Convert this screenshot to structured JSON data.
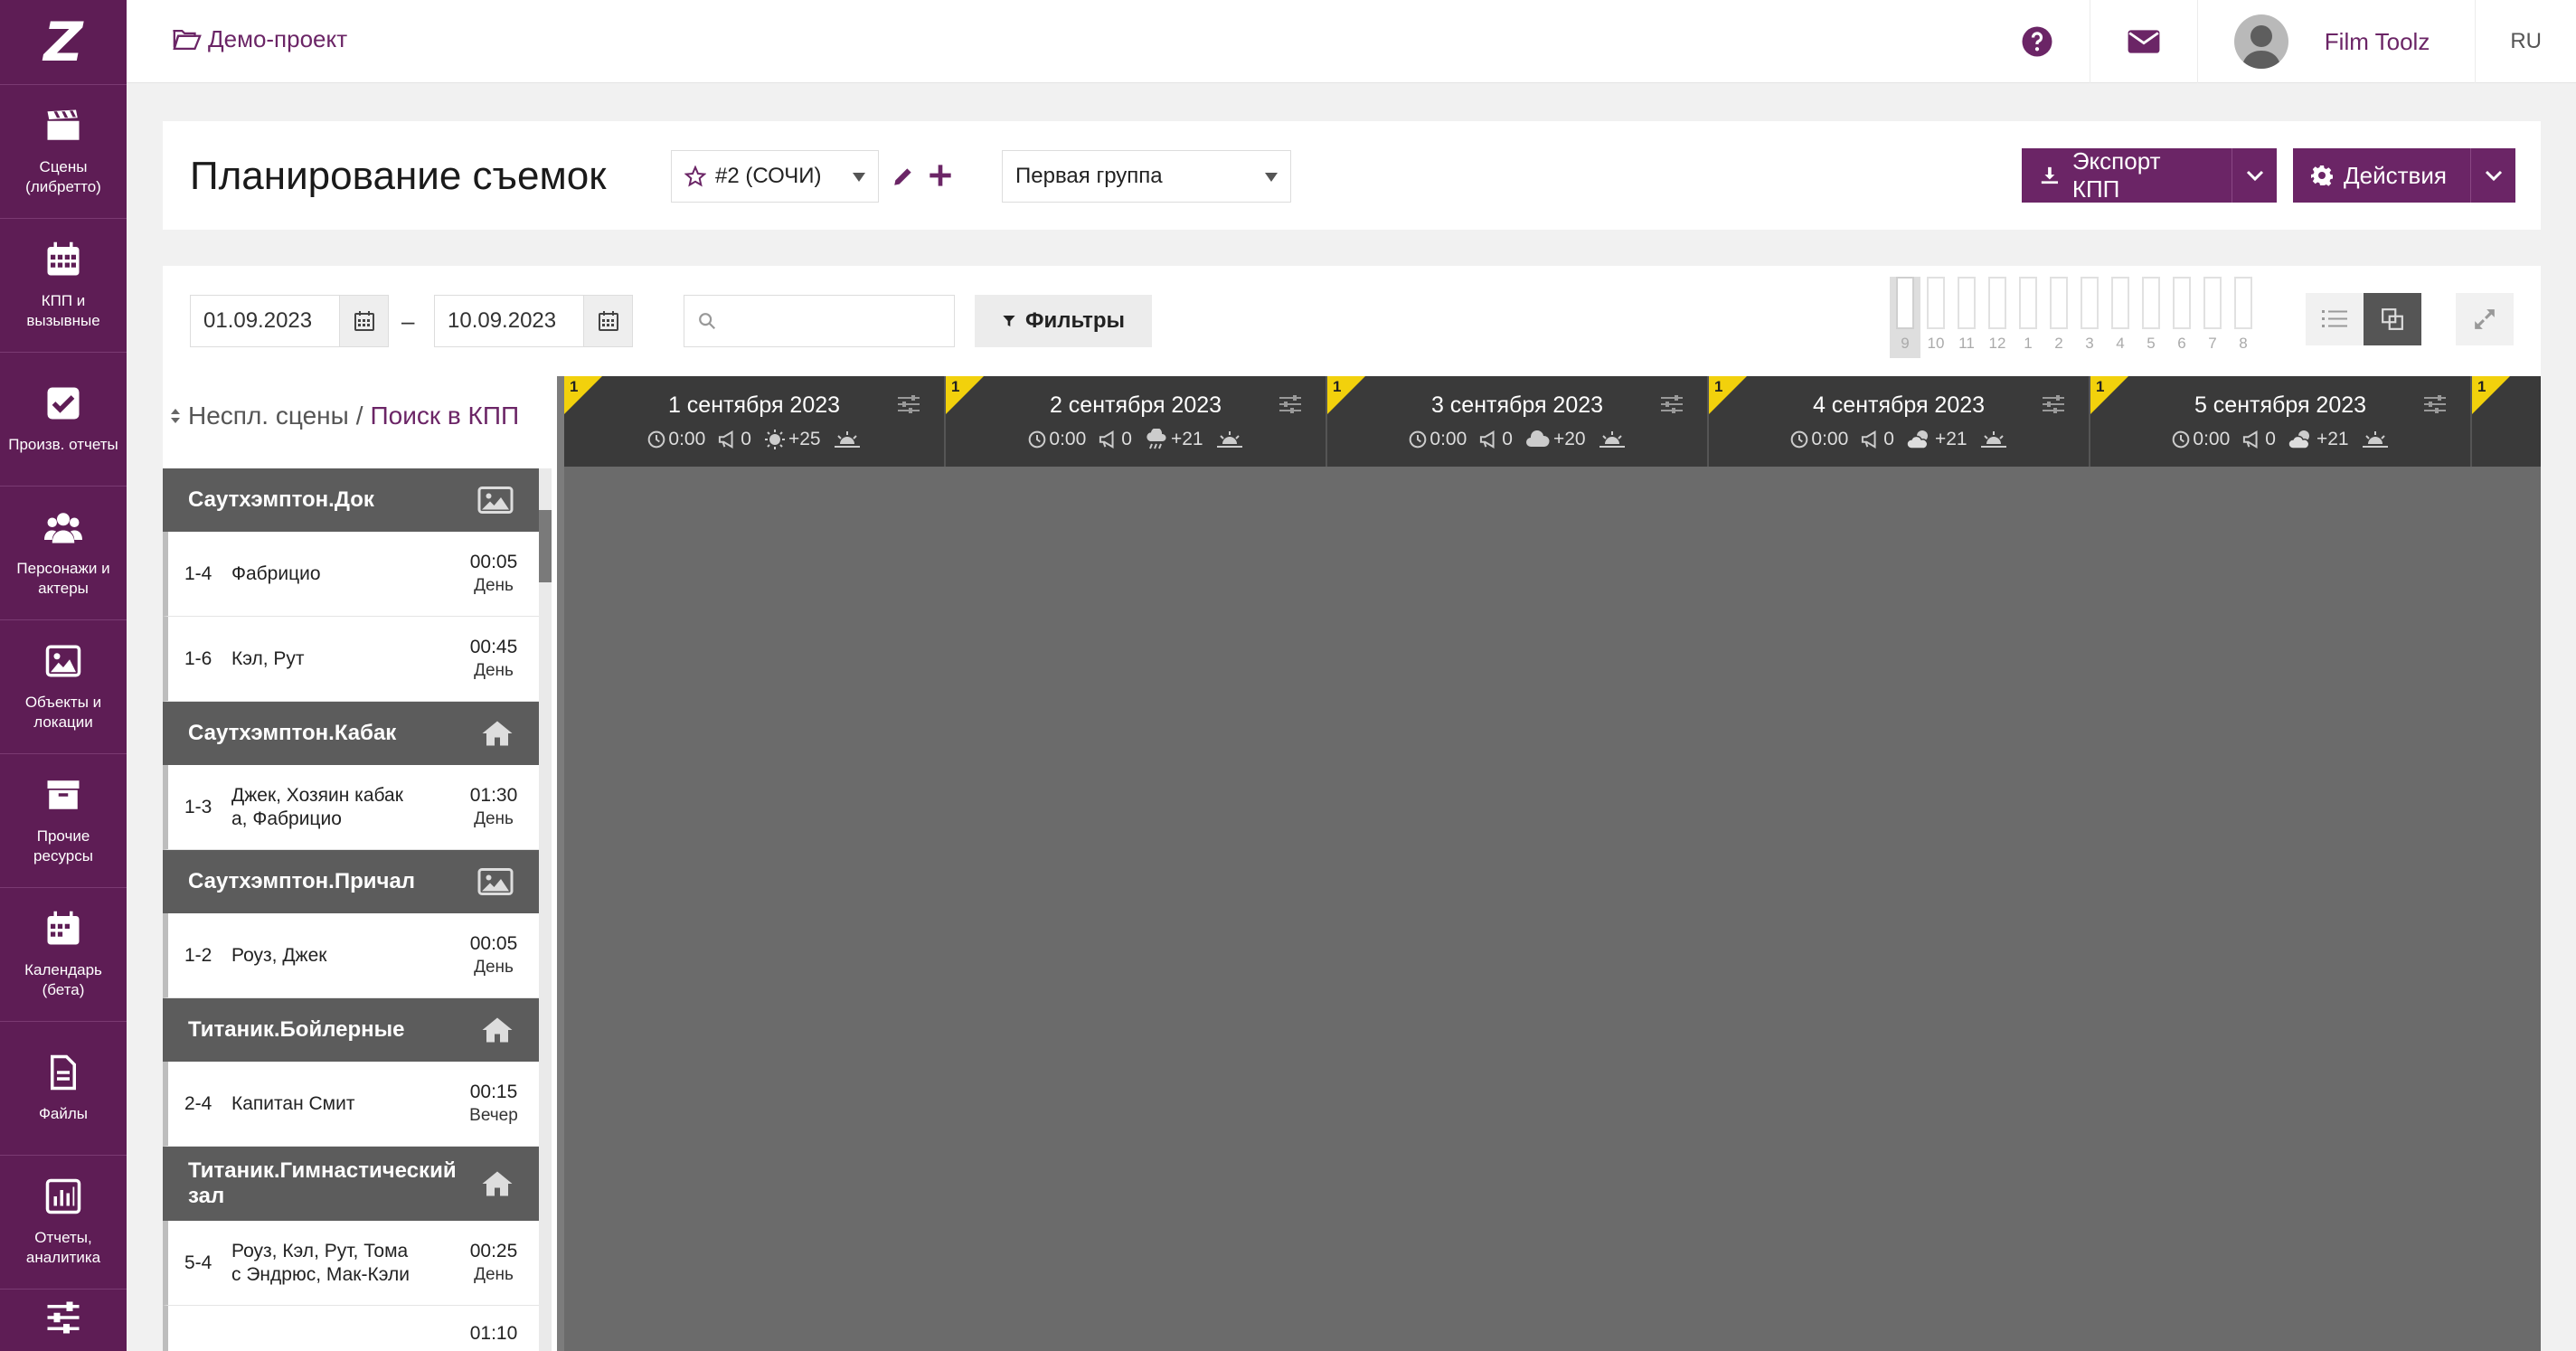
{
  "sidebar": {
    "logo": "Z",
    "items": [
      {
        "label": "Сцены\n(либретто)",
        "icon": "clapperboard-icon"
      },
      {
        "label": "КПП и\nвызывные",
        "icon": "calendar-grid-icon"
      },
      {
        "label": "Произв. отчеты",
        "icon": "checkbox-icon"
      },
      {
        "label": "Персонажи и\nактеры",
        "icon": "users-icon"
      },
      {
        "label": "Объекты и\nлокации",
        "icon": "image-icon"
      },
      {
        "label": "Прочие\nресурсы",
        "icon": "archive-icon"
      },
      {
        "label": "Календарь\n(бета)",
        "icon": "calendar-icon"
      },
      {
        "label": "Файлы",
        "icon": "file-icon"
      },
      {
        "label": "Отчеты,\nаналитика",
        "icon": "bar-chart-icon"
      },
      {
        "label": "",
        "icon": "sliders-icon"
      }
    ]
  },
  "topbar": {
    "project": "Демо-проект",
    "username": "Film Toolz",
    "lang": "RU"
  },
  "header": {
    "title": "Планирование съемок",
    "schedule_select": "#2 (СОЧИ)",
    "group_select": "Первая группа",
    "export_label": "Экспорт КПП",
    "actions_label": "Действия"
  },
  "toolbar": {
    "date_from": "01.09.2023",
    "date_sep": "–",
    "date_to": "10.09.2023",
    "search_placeholder": "",
    "filters_label": "Фильтры",
    "mini_days": [
      "9",
      "10",
      "11",
      "12",
      "1",
      "2",
      "3",
      "4",
      "5",
      "6",
      "7",
      "8"
    ]
  },
  "panel": {
    "label": "Неспл. сцены",
    "sep": "/",
    "link": "Поиск в КПП"
  },
  "groups": [
    {
      "name": "Саутхэмптон.Док",
      "icon": "image-icon",
      "scenes": [
        {
          "num": "1-4",
          "chars": "Фабрицио",
          "time": "00:05",
          "period": "День"
        },
        {
          "num": "1-6",
          "chars": "Кэл, Рут",
          "time": "00:45",
          "period": "День"
        }
      ]
    },
    {
      "name": "Саутхэмптон.Кабак",
      "icon": "home-icon",
      "scenes": [
        {
          "num": "1-3",
          "chars": "Джек, Хозяин кабак\nа, Фабрицио",
          "time": "01:30",
          "period": "День"
        }
      ]
    },
    {
      "name": "Саутхэмптон.Причал",
      "icon": "image-icon",
      "scenes": [
        {
          "num": "1-2",
          "chars": "Роуз, Джек",
          "time": "00:05",
          "period": "День"
        }
      ]
    },
    {
      "name": "Титаник.Бойлерные",
      "icon": "home-icon",
      "scenes": [
        {
          "num": "2-4",
          "chars": "Капитан Смит",
          "time": "00:15",
          "period": "Вечер"
        }
      ]
    },
    {
      "name": "Титаник.Гимнастический\nзал",
      "icon": "home-icon",
      "scenes": [
        {
          "num": "5-4",
          "chars": "Роуз, Кэл, Рут, Тома\nс Эндрюс, Мак-Кэли",
          "time": "00:25",
          "period": "День"
        },
        {
          "num": "",
          "chars": "",
          "time": "01:10",
          "period": ""
        }
      ]
    }
  ],
  "days": [
    {
      "title": "1 сентября 2023",
      "corner": "1",
      "time": "0:00",
      "calls": "0",
      "weather": "sun-icon",
      "temp": "+25"
    },
    {
      "title": "2 сентября 2023",
      "corner": "1",
      "time": "0:00",
      "calls": "0",
      "weather": "rain-cloud-icon",
      "temp": "+21"
    },
    {
      "title": "3 сентября 2023",
      "corner": "1",
      "time": "0:00",
      "calls": "0",
      "weather": "cloud-icon",
      "temp": "+20"
    },
    {
      "title": "4 сентября 2023",
      "corner": "1",
      "time": "0:00",
      "calls": "0",
      "weather": "partly-cloudy-icon",
      "temp": "+21"
    },
    {
      "title": "5 сентября 2023",
      "corner": "1",
      "time": "0:00",
      "calls": "0",
      "weather": "partly-cloudy-icon",
      "temp": "+21"
    },
    {
      "title": "",
      "corner": "1",
      "time": "",
      "calls": "",
      "weather": "",
      "temp": ""
    }
  ],
  "colors": {
    "brand": "#6b2566",
    "sidebar": "#5e1d55",
    "group_header": "#5c5c5c",
    "calendar_header": "#3a3a3a",
    "calendar_body": "#6b6b6b",
    "day_marker": "#f2d10c"
  }
}
